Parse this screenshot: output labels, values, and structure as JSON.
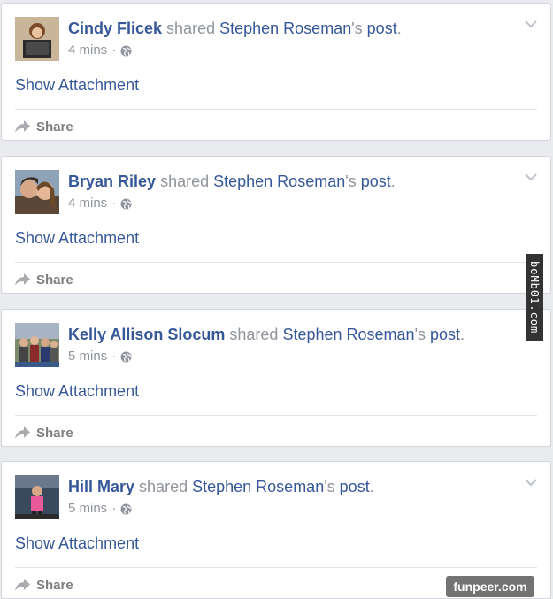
{
  "posts": [
    {
      "actor": "Cindy Flicek",
      "verb": "shared",
      "owner": "Stephen Roseman",
      "possessive": "'s",
      "object": "post",
      "period": ".",
      "time": "4 mins",
      "separator": "·",
      "attachment_label": "Show Attachment",
      "share_label": "Share"
    },
    {
      "actor": "Bryan Riley",
      "verb": "shared",
      "owner": "Stephen Roseman",
      "possessive": "'s",
      "object": "post",
      "period": ".",
      "time": "4 mins",
      "separator": "·",
      "attachment_label": "Show Attachment",
      "share_label": "Share"
    },
    {
      "actor": "Kelly Allison Slocum",
      "verb": "shared",
      "owner": "Stephen Roseman",
      "possessive": "'s",
      "object": "post",
      "period": ".",
      "time": "5 mins",
      "separator": "·",
      "attachment_label": "Show Attachment",
      "share_label": "Share"
    },
    {
      "actor": "Hill Mary",
      "verb": "shared",
      "owner": "Stephen Roseman",
      "possessive": "'s",
      "object": "post",
      "period": ".",
      "time": "5 mins",
      "separator": "·",
      "attachment_label": "Show Attachment",
      "share_label": "Share"
    }
  ],
  "icons": {
    "privacy": "globe-icon",
    "share": "share-arrow-icon",
    "menu": "chevron-down-icon"
  },
  "colors": {
    "link": "#365899",
    "meta": "#90949c",
    "share": "#7f7f7f",
    "background": "#e9ebee"
  },
  "watermarks": {
    "side": "boMb01.com",
    "bottom": "funpeer.com"
  }
}
